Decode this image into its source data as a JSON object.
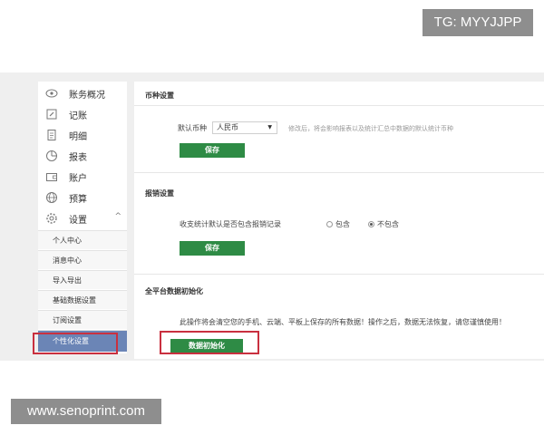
{
  "watermarks": {
    "top": "TG: MYYJJPP",
    "bottom": "www.senoprint.com"
  },
  "sidebar": {
    "items": [
      {
        "label": "账务概况",
        "icon": "eye-icon"
      },
      {
        "label": "记账",
        "icon": "edit-icon"
      },
      {
        "label": "明细",
        "icon": "document-icon"
      },
      {
        "label": "报表",
        "icon": "pie-chart-icon"
      },
      {
        "label": "账户",
        "icon": "wallet-icon"
      },
      {
        "label": "预算",
        "icon": "globe-icon"
      },
      {
        "label": "设置",
        "icon": "gear-icon"
      }
    ],
    "submenu": [
      "个人中心",
      "消息中心",
      "导入导出",
      "基础数据设置",
      "订阅设置",
      "个性化设置"
    ],
    "active_submenu": "个性化设置"
  },
  "currency": {
    "title": "币种设置",
    "label": "默认币种",
    "selected": "人民币",
    "hint": "修改后，将会影响报表以及统计汇总中数据的默认统计币种",
    "save": "保存"
  },
  "refund": {
    "title": "报销设置",
    "label": "收支统计默认是否包含报销记录",
    "option_include": "包含",
    "option_exclude": "不包含",
    "selected": "不包含",
    "save": "保存"
  },
  "reset": {
    "title": "全平台数据初始化",
    "warning": "此操作将会清空您的手机、云端、平板上保存的所有数据！操作之后，数据无法恢复，请您谨慎使用！",
    "button": "数据初始化"
  },
  "colors": {
    "accent_green": "#2e8b45",
    "active_blue": "#6b85b6",
    "highlight_red": "#c9303f"
  }
}
